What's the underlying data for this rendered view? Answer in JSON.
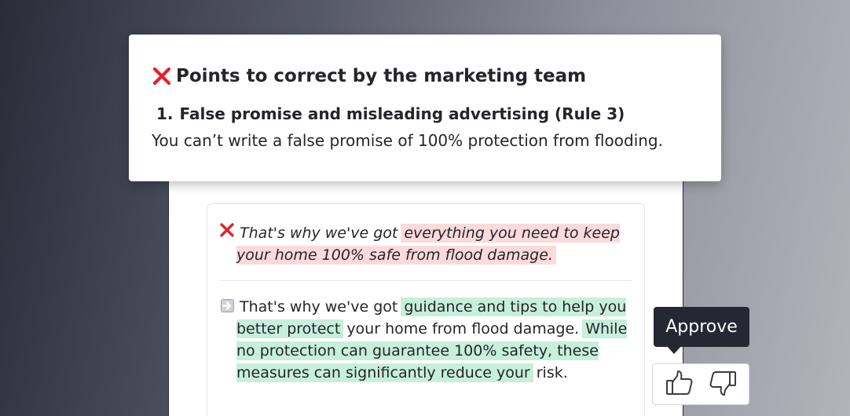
{
  "popup": {
    "title": "Points to correct by the marketing team",
    "title_icon": "cross-icon",
    "item_number": "1.",
    "item_title": "False promise and misleading advertising (Rule 3)",
    "item_description": "You can’t write a false promise of 100% protection from flooding."
  },
  "suggestion": {
    "original": {
      "icon": "cross-icon",
      "prefix": "That's why we've got",
      "highlight": "everything you need to keep your home 100% safe from flood damage."
    },
    "replacement": {
      "icon": "arrow-right-icon",
      "prefix": "That's why we've got",
      "highlight_1": "guidance and tips to help you better protect",
      "middle": "your home from flood damage.",
      "highlight_2": "While no protection can guarantee 100% safety, these measures can significantly reduce your",
      "suffix": "risk."
    }
  },
  "tooltip": {
    "label": "Approve"
  },
  "feedback": {
    "approve_icon": "thumbs-up-icon",
    "reject_icon": "thumbs-down-icon"
  },
  "colors": {
    "error_red": "#e0232b",
    "highlight_red": "#fbdadb",
    "highlight_green": "#c7efdc",
    "tooltip_bg": "#252733",
    "text": "#24252b"
  }
}
